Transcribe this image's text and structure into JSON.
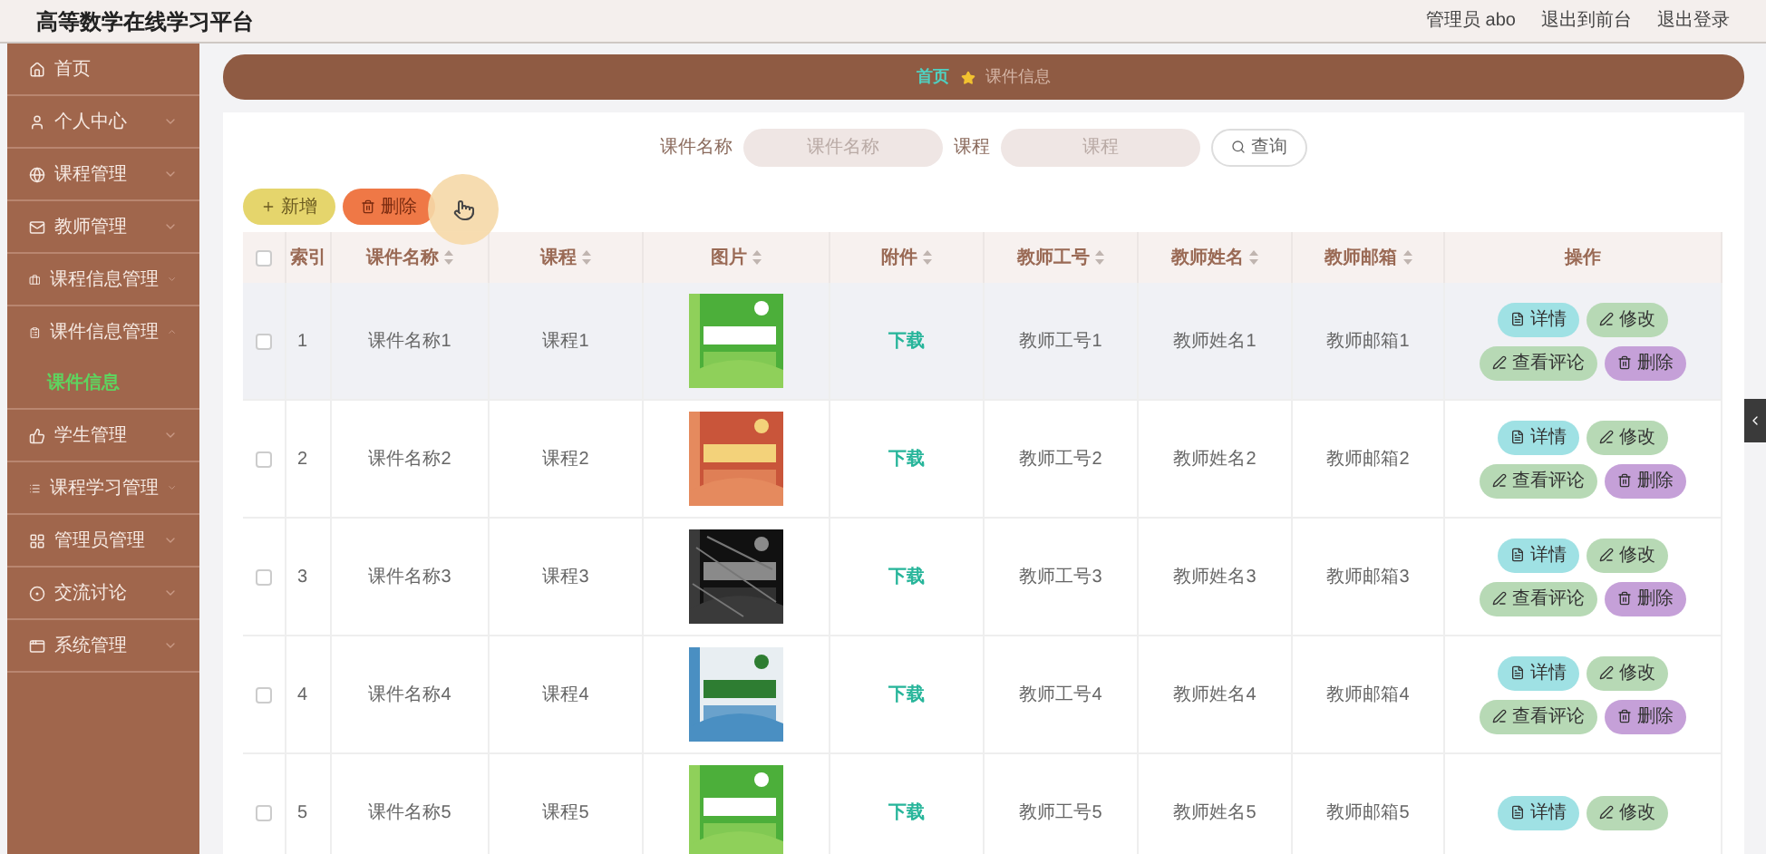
{
  "header": {
    "title": "高等数学在线学习平台",
    "links": [
      "管理员 abo",
      "退出到前台",
      "退出登录"
    ]
  },
  "sidebar": {
    "items": [
      {
        "label": "首页",
        "kind": "link"
      },
      {
        "label": "个人中心",
        "kind": "menu",
        "expanded": false
      },
      {
        "label": "课程管理",
        "kind": "menu",
        "expanded": false
      },
      {
        "label": "教师管理",
        "kind": "menu",
        "expanded": false
      },
      {
        "label": "课程信息管理",
        "kind": "menu",
        "expanded": false
      },
      {
        "label": "课件信息管理",
        "kind": "menu",
        "expanded": true,
        "children": [
          {
            "label": "课件信息",
            "selected": true
          }
        ]
      },
      {
        "label": "学生管理",
        "kind": "menu",
        "expanded": false
      },
      {
        "label": "课程学习管理",
        "kind": "menu",
        "expanded": false
      },
      {
        "label": "管理员管理",
        "kind": "menu",
        "expanded": false
      },
      {
        "label": "交流讨论",
        "kind": "menu",
        "expanded": false
      },
      {
        "label": "系统管理",
        "kind": "menu",
        "expanded": false
      }
    ]
  },
  "breadcrumb": [
    "首页",
    "课件信息"
  ],
  "search": {
    "fields": [
      {
        "label": "课件名称",
        "placeholder": "课件名称"
      },
      {
        "label": "课程",
        "placeholder": "课程"
      }
    ],
    "button": "查询"
  },
  "actions": [
    {
      "label": "新增",
      "kind": "add"
    },
    {
      "label": "删除",
      "kind": "delete"
    }
  ],
  "table": {
    "header_checked": false,
    "columns": [
      {
        "label": "索引",
        "sortable": false
      },
      {
        "label": "课件名称",
        "sortable": true
      },
      {
        "label": "课程",
        "sortable": true
      },
      {
        "label": "图片",
        "sortable": true
      },
      {
        "label": "附件",
        "sortable": true
      },
      {
        "label": "教师工号",
        "sortable": true
      },
      {
        "label": "教师姓名",
        "sortable": true
      },
      {
        "label": "教师邮箱",
        "sortable": true
      },
      {
        "label": "操作",
        "sortable": false
      }
    ],
    "rows": [
      {
        "checked": false,
        "highlighted": true,
        "index": "1",
        "name": "课件名称1",
        "course": "课程1",
        "picture": {
          "kind": "picture"
        },
        "attachment": "下载",
        "teacher_id": "教师工号1",
        "teacher_name": "教师姓名1",
        "teacher_email": "教师邮箱1",
        "actions": [
          {
            "label": "详情",
            "kind": "detail"
          },
          {
            "label": "修改",
            "kind": "edit"
          },
          {
            "label": "查看评论",
            "kind": "comments"
          },
          {
            "label": "删除",
            "kind": "delete"
          }
        ]
      },
      {
        "checked": false,
        "highlighted": false,
        "index": "2",
        "name": "课件名称2",
        "course": "课程2",
        "picture": {
          "kind": "picture"
        },
        "attachment": "下载",
        "teacher_id": "教师工号2",
        "teacher_name": "教师姓名2",
        "teacher_email": "教师邮箱2",
        "actions": [
          {
            "label": "详情",
            "kind": "detail"
          },
          {
            "label": "修改",
            "kind": "edit"
          },
          {
            "label": "查看评论",
            "kind": "comments"
          },
          {
            "label": "删除",
            "kind": "delete"
          }
        ]
      },
      {
        "checked": false,
        "highlighted": false,
        "index": "3",
        "name": "课件名称3",
        "course": "课程3",
        "picture": {
          "kind": "picture"
        },
        "attachment": "下载",
        "teacher_id": "教师工号3",
        "teacher_name": "教师姓名3",
        "teacher_email": "教师邮箱3",
        "actions": [
          {
            "label": "详情",
            "kind": "detail"
          },
          {
            "label": "修改",
            "kind": "edit"
          },
          {
            "label": "查看评论",
            "kind": "comments"
          },
          {
            "label": "删除",
            "kind": "delete"
          }
        ]
      },
      {
        "checked": false,
        "highlighted": false,
        "index": "4",
        "name": "课件名称4",
        "course": "课程4",
        "picture": {
          "kind": "picture"
        },
        "attachment": "下载",
        "teacher_id": "教师工号4",
        "teacher_name": "教师姓名4",
        "teacher_email": "教师邮箱4",
        "actions": [
          {
            "label": "详情",
            "kind": "detail"
          },
          {
            "label": "修改",
            "kind": "edit"
          },
          {
            "label": "查看评论",
            "kind": "comments"
          },
          {
            "label": "删除",
            "kind": "delete"
          }
        ]
      },
      {
        "checked": false,
        "highlighted": false,
        "index": "5",
        "name": "课件名称5",
        "course": "课程5",
        "picture": {
          "kind": "picture"
        },
        "attachment": "下载",
        "teacher_id": "教师工号5",
        "teacher_name": "教师姓名5",
        "teacher_email": "教师邮箱5",
        "actions": [
          {
            "label": "详情",
            "kind": "detail"
          },
          {
            "label": "修改",
            "kind": "edit"
          }
        ]
      }
    ]
  }
}
